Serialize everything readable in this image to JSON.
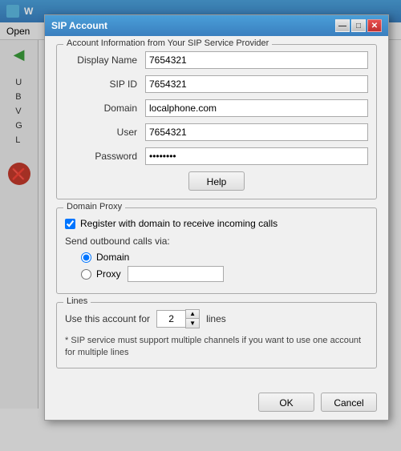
{
  "app": {
    "title": "W",
    "menu": [
      "Open"
    ]
  },
  "dialog": {
    "title": "SIP Account",
    "titlebar_buttons": {
      "minimize": "—",
      "maximize": "□",
      "close": "✕"
    },
    "sections": {
      "account_info": {
        "legend": "Account Information from Your SIP Service Provider",
        "fields": {
          "display_name": {
            "label": "Display Name",
            "value": "7654321"
          },
          "sip_id": {
            "label": "SIP ID",
            "value": "7654321"
          },
          "domain": {
            "label": "Domain",
            "value": "localphone.com"
          },
          "user": {
            "label": "User",
            "value": "7654321"
          },
          "password": {
            "label": "Password",
            "value": "••••••••"
          }
        },
        "help_button": "Help"
      },
      "domain_proxy": {
        "legend": "Domain Proxy",
        "checkbox_label": "Register with domain to receive incoming calls",
        "send_label": "Send outbound calls via:",
        "domain_radio": "Domain",
        "proxy_radio": "Proxy",
        "proxy_value": ""
      },
      "lines": {
        "legend": "Lines",
        "use_label": "Use this account for",
        "count": "2",
        "suffix": "lines",
        "note": "* SIP service must support multiple channels if you want to use one account for multiple lines"
      }
    },
    "footer": {
      "ok": "OK",
      "cancel": "Cancel"
    }
  },
  "side_panel": {
    "items": [
      "U",
      "B",
      "V",
      "G",
      "L"
    ]
  }
}
